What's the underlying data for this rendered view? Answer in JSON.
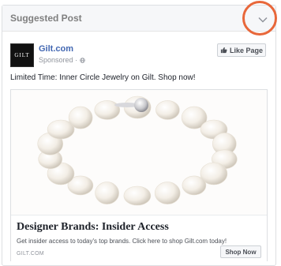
{
  "header": {
    "title": "Suggested Post",
    "menu_icon": "chevron-down-icon"
  },
  "annotation": {
    "color": "#e8673a",
    "shape": "circle"
  },
  "post": {
    "page_name": "Gilt.com",
    "logo_text": "GILT",
    "sponsored_label": "Sponsored",
    "sponsored_icon": "globe-icon",
    "like_button": {
      "label": "Like Page",
      "icon": "thumbs-up-icon"
    },
    "text": "Limited Time: Inner Circle Jewelry on Gilt. Shop now!"
  },
  "link": {
    "image_description_icon": "pearl-bracelet-image",
    "headline": "Designer Brands: Insider Access",
    "description": "Get insider access to today's top brands. Click here to shop Gilt.com today!",
    "domain": "GILT.COM",
    "cta_label": "Shop Now"
  },
  "colors": {
    "link_blue": "#4267b2",
    "annotation_orange": "#e8673a"
  }
}
